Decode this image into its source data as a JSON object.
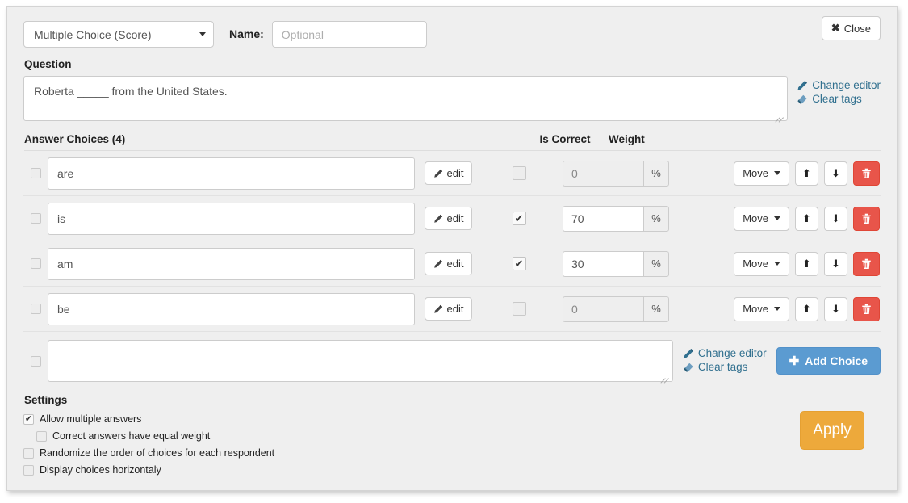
{
  "header": {
    "question_type": "Multiple Choice (Score)",
    "name_label": "Name:",
    "name_value": "",
    "name_placeholder": "Optional",
    "close_label": "Close",
    "close_icon": "x-icon",
    "caret_icon": "chevron-down-icon"
  },
  "question": {
    "title": "Question",
    "text": "Roberta _____ from the United States.",
    "change_editor_label": "Change editor",
    "clear_tags_label": "Clear tags",
    "pencil_icon": "pencil-icon",
    "eraser_icon": "eraser-icon"
  },
  "choices": {
    "title": "Answer Choices (4)",
    "count": 4,
    "col_is_correct": "Is Correct",
    "col_weight": "Weight",
    "edit_label": "edit",
    "move_label": "Move",
    "up_icon": "arrow-up-icon",
    "down_icon": "arrow-down-icon",
    "delete_icon": "trash-icon",
    "percent_symbol": "%",
    "rows": [
      {
        "text": "are",
        "selected": false,
        "is_correct": false,
        "weight": "0",
        "weight_disabled": true
      },
      {
        "text": "is",
        "selected": false,
        "is_correct": true,
        "weight": "70",
        "weight_disabled": false
      },
      {
        "text": "am",
        "selected": false,
        "is_correct": true,
        "weight": "30",
        "weight_disabled": false
      },
      {
        "text": "be",
        "selected": false,
        "is_correct": false,
        "weight": "0",
        "weight_disabled": true
      }
    ]
  },
  "add_choice": {
    "value": "",
    "change_editor_label": "Change editor",
    "clear_tags_label": "Clear tags",
    "button_label": "Add Choice",
    "plus_icon": "plus-icon"
  },
  "settings": {
    "title": "Settings",
    "items": [
      {
        "label": "Allow multiple answers",
        "checked": true,
        "indent": false
      },
      {
        "label": "Correct answers have equal weight",
        "checked": false,
        "indent": true
      },
      {
        "label": "Randomize the order of choices for each respondent",
        "checked": false,
        "indent": false
      },
      {
        "label": "Display choices horizontaly",
        "checked": false,
        "indent": false
      }
    ]
  },
  "footer": {
    "apply_label": "Apply"
  },
  "colors": {
    "panel_bg": "#efefef",
    "link": "#31708f",
    "delete_red": "#e8554a",
    "add_blue": "#5b9bd1",
    "apply_orange": "#eda93b"
  }
}
